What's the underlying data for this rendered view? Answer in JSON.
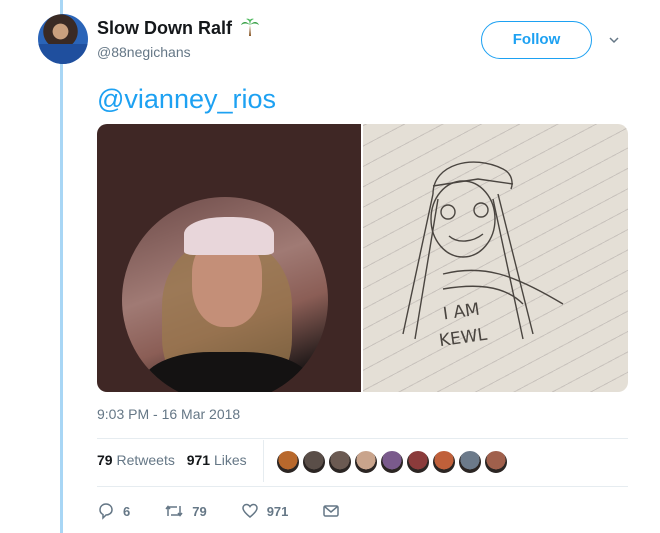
{
  "tweet": {
    "author": {
      "display_name": "Slow Down Ralf",
      "handle": "@88negichans",
      "name_emoji": "palm-tree-icon"
    },
    "follow_label": "Follow",
    "text": "@vianney_rios",
    "drawing_text": [
      "I AM",
      "KEWL"
    ],
    "timestamp": "9:03 PM - 16 Mar 2018",
    "stats": {
      "retweets_count": "79",
      "retweets_label": "Retweets",
      "likes_count": "971",
      "likes_label": "Likes"
    },
    "likers": [
      "#b8682c",
      "#5a4e48",
      "#6b5a52",
      "#c9a48c",
      "#7a5a8c",
      "#8b3b3b",
      "#c0603a",
      "#6c7a8a",
      "#a0604c"
    ],
    "actions": {
      "reply_count": "6",
      "retweet_count": "79",
      "like_count": "971"
    }
  },
  "colors": {
    "accent": "#1da1f2",
    "thread_line": "#a8d6f5",
    "muted": "#657786"
  }
}
